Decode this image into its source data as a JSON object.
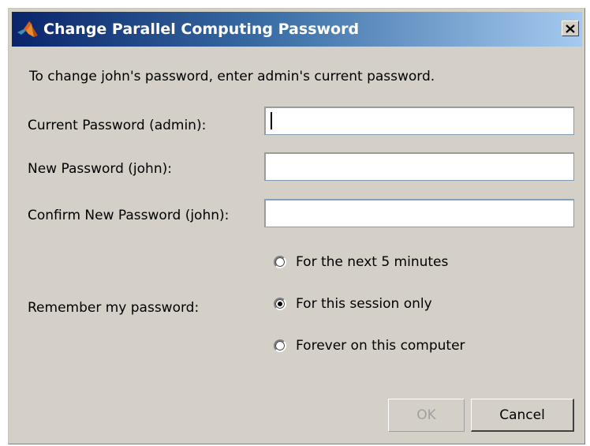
{
  "window": {
    "title": "Change Parallel Computing Password",
    "icon": "matlab-logo-icon",
    "close_icon": "close-icon"
  },
  "form": {
    "instruction": "To change john's password, enter admin's current password.",
    "current_password_label": "Current Password (admin):",
    "current_password_value": "",
    "new_password_label": "New Password (john):",
    "new_password_value": "",
    "confirm_password_label": "Confirm New Password (john):",
    "confirm_password_value": "",
    "remember_label": "Remember my password:"
  },
  "remember_options": [
    {
      "label": "For the next 5 minutes",
      "checked": false
    },
    {
      "label": "For this session only",
      "checked": true
    },
    {
      "label": "Forever on this computer",
      "checked": false
    }
  ],
  "buttons": {
    "ok_label": "OK",
    "ok_enabled": false,
    "cancel_label": "Cancel"
  },
  "colors": {
    "title_gradient_start": "#0a246a",
    "title_gradient_end": "#a6caf0",
    "dialog_background": "#d4d0c8"
  }
}
